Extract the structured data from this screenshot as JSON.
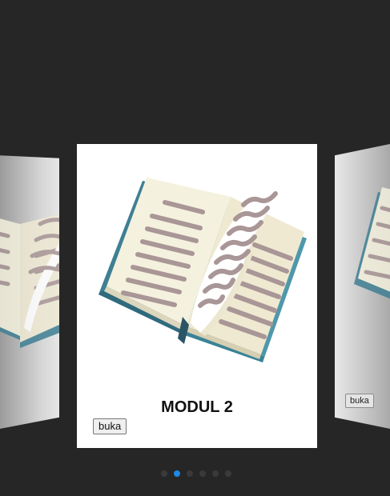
{
  "carousel": {
    "current_card": {
      "title": "MODUL 2",
      "button_label": "buka",
      "icon": "open-book-icon"
    },
    "right_card": {
      "button_label": "buka",
      "icon": "open-book-icon"
    },
    "left_card": {
      "icon": "open-book-icon"
    },
    "pagination": {
      "count": 6,
      "active_index": 1,
      "active_color": "#1e88e5"
    }
  },
  "colors": {
    "background": "#262626",
    "card": "#ffffff",
    "book_cover": "#4a8fa6",
    "page": "#f3f0dd",
    "text_lines": "#a99696"
  }
}
